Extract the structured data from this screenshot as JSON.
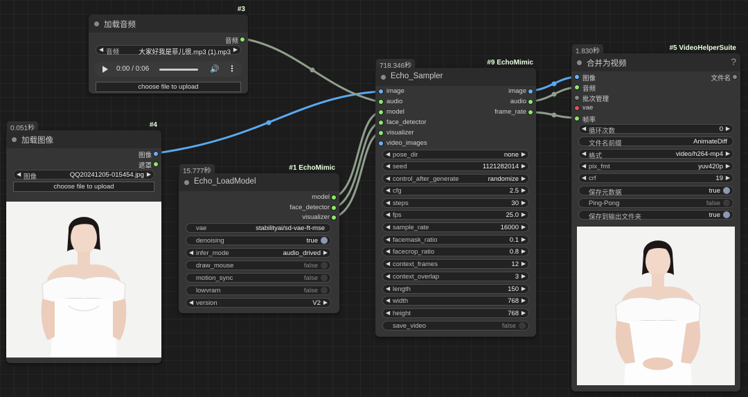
{
  "colors": {
    "image_wire": "#5aa9f0",
    "other_wire": "#8f9f8c",
    "port_image": "#6ab0ff",
    "port_green": "#8dea6a",
    "port_red": "#e05555",
    "port_gray": "#888888"
  },
  "node3": {
    "tag": "#3",
    "title": "加载音频",
    "output": "音频",
    "file_widget": {
      "name": "音频",
      "value": "大家好我是菲儿很.mp3 (1).mp3"
    },
    "player": {
      "time": "0:00 / 0:06"
    },
    "upload": "choose file to upload"
  },
  "node4": {
    "time": "0.051秒",
    "tag": "#4",
    "title": "加载图像",
    "outputs": [
      "图像",
      "遮罩"
    ],
    "file_widget": {
      "name": "图像",
      "value": "QQ20241205-015454.jpg"
    },
    "upload": "choose file to upload"
  },
  "node1": {
    "time": "15.777秒",
    "tag": "#1 EchoMimic",
    "title": "Echo_LoadModel",
    "outputs": [
      "model",
      "face_detector",
      "visualizer"
    ],
    "widgets": [
      {
        "name": "vae",
        "value": "stabilityai/sd-vae-ft-mse"
      },
      {
        "name": "denoising",
        "value": "true"
      },
      {
        "name": "infer_mode",
        "value": "audio_drived"
      },
      {
        "name": "draw_mouse",
        "value": "false"
      },
      {
        "name": "motion_sync",
        "value": "false"
      },
      {
        "name": "lowvram",
        "value": "false"
      },
      {
        "name": "version",
        "value": "V2"
      }
    ]
  },
  "node9": {
    "time": "718.346秒",
    "tag": "#9 EchoMimic",
    "title": "Echo_Sampler",
    "inputs": [
      "image",
      "audio",
      "model",
      "face_detector",
      "visualizer",
      "video_images"
    ],
    "outputs": [
      "image",
      "audio",
      "frame_rate"
    ],
    "widgets": [
      {
        "name": "pose_dir",
        "value": "none"
      },
      {
        "name": "seed",
        "value": "1121282014"
      },
      {
        "name": "control_after_generate",
        "value": "randomize"
      },
      {
        "name": "cfg",
        "value": "2.5"
      },
      {
        "name": "steps",
        "value": "30"
      },
      {
        "name": "fps",
        "value": "25.0"
      },
      {
        "name": "sample_rate",
        "value": "16000"
      },
      {
        "name": "facemask_ratio",
        "value": "0.1"
      },
      {
        "name": "facecrop_ratio",
        "value": "0.8"
      },
      {
        "name": "context_frames",
        "value": "12"
      },
      {
        "name": "context_overlap",
        "value": "3"
      },
      {
        "name": "length",
        "value": "150"
      },
      {
        "name": "width",
        "value": "768"
      },
      {
        "name": "height",
        "value": "768"
      },
      {
        "name": "save_video",
        "value": "false"
      }
    ]
  },
  "node5": {
    "time": "1.830秒",
    "tag": "#5 VideoHelperSuite",
    "title": "合并为视频",
    "help": "?",
    "inputs": [
      "图像",
      "音频",
      "批次管理",
      "vae",
      "帧率"
    ],
    "output": "文件名",
    "widgets": [
      {
        "name": "循环次数",
        "value": "0"
      },
      {
        "name": "文件名前缀",
        "value": "AnimateDiff"
      },
      {
        "name": "格式",
        "value": "video/h264-mp4"
      },
      {
        "name": "pix_fmt",
        "value": "yuv420p"
      },
      {
        "name": "crf",
        "value": "19"
      },
      {
        "name": "保存元数据",
        "value": "true"
      },
      {
        "name": "Ping-Pong",
        "value": "false"
      },
      {
        "name": "保存到输出文件夹",
        "value": "true"
      }
    ]
  }
}
